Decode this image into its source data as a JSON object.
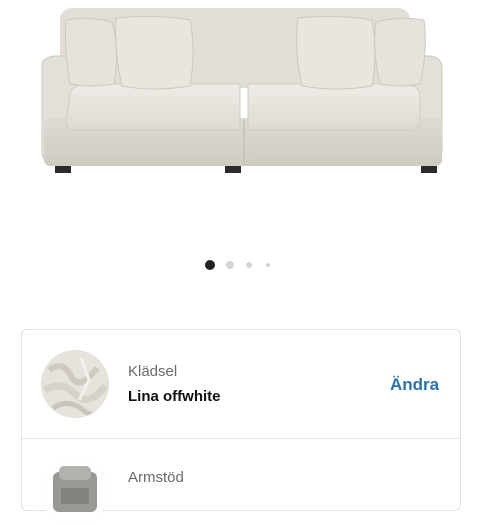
{
  "product": {
    "image_description": "sofa-image"
  },
  "carousel": {
    "total": 4,
    "active_index": 0
  },
  "options": [
    {
      "label": "Klädsel",
      "value": "Lina offwhite",
      "action": "Ändra"
    },
    {
      "label": "Armstöd",
      "value": "",
      "action": ""
    }
  ],
  "colors": {
    "accent": "#2a73b3",
    "sofa_fabric": "#e6e2dc"
  }
}
